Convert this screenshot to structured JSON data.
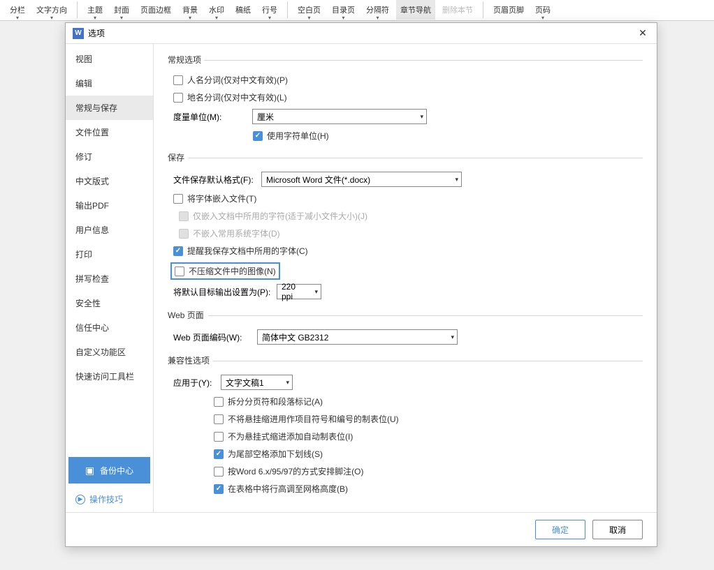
{
  "ribbon": {
    "items": [
      {
        "label": "分栏",
        "arrow": true
      },
      {
        "label": "文字方向",
        "arrow": true
      },
      {
        "label": "主题",
        "arrow": true
      },
      {
        "label": "封面",
        "arrow": true
      },
      {
        "label": "页面边框",
        "arrow": false
      },
      {
        "label": "背景",
        "arrow": true
      },
      {
        "label": "水印",
        "arrow": true
      },
      {
        "label": "稿纸",
        "arrow": false
      },
      {
        "label": "行号",
        "arrow": true
      },
      {
        "label": "空白页",
        "arrow": true
      },
      {
        "label": "目录页",
        "arrow": true
      },
      {
        "label": "分隔符",
        "arrow": true
      },
      {
        "label": "章节导航",
        "arrow": false,
        "active": true
      },
      {
        "label": "删除本节",
        "arrow": false,
        "disabled": true
      },
      {
        "label": "页眉页脚",
        "arrow": false
      },
      {
        "label": "页码",
        "arrow": true
      }
    ]
  },
  "dialog": {
    "title": "选项",
    "close": "✕"
  },
  "sidebar": {
    "items": [
      {
        "label": "视图"
      },
      {
        "label": "编辑"
      },
      {
        "label": "常规与保存",
        "active": true
      },
      {
        "label": "文件位置"
      },
      {
        "label": "修订"
      },
      {
        "label": "中文版式"
      },
      {
        "label": "输出PDF"
      },
      {
        "label": "用户信息"
      },
      {
        "label": "打印"
      },
      {
        "label": "拼写检查"
      },
      {
        "label": "安全性"
      },
      {
        "label": "信任中心"
      },
      {
        "label": "自定义功能区"
      },
      {
        "label": "快速访问工具栏"
      }
    ],
    "backup": "备份中心",
    "tips": "操作技巧"
  },
  "sections": {
    "general": {
      "title": "常规选项",
      "name_seg": "人名分词(仅对中文有效)(P)",
      "place_seg": "地名分词(仅对中文有效)(L)",
      "unit_label": "度量单位(M):",
      "unit_value": "厘米",
      "char_unit": "使用字符单位(H)"
    },
    "save": {
      "title": "保存",
      "format_label": "文件保存默认格式(F):",
      "format_value": "Microsoft Word 文件(*.docx)",
      "embed_fonts": "将字体嵌入文件(T)",
      "embed_used": "仅嵌入文档中所用的字符(适于减小文件大小)(J)",
      "no_sys_fonts": "不嵌入常用系统字体(D)",
      "remind_fonts": "提醒我保存文档中所用的字体(C)",
      "no_compress": "不压缩文件中的图像(N)",
      "output_label": "将默认目标输出设置为(P):",
      "output_value": "220 ppi"
    },
    "web": {
      "title": "Web 页面",
      "encoding_label": "Web 页面编码(W):",
      "encoding_value": "简体中文 GB2312"
    },
    "compat": {
      "title": "兼容性选项",
      "apply_label": "应用于(Y):",
      "apply_value": "文字文稿1",
      "split_break": "拆分分页符和段落标记(A)",
      "no_hang_tab": "不将悬挂缩进用作项目符号和编号的制表位(U)",
      "no_auto_tab": "不为悬挂式缩进添加自动制表位(I)",
      "underline_trail": "为尾部空格添加下划线(S)",
      "word6_footnote": "按Word 6.x/95/97的方式安排脚注(O)",
      "table_row_grid": "在表格中将行高调至网格高度(B)"
    }
  },
  "footer": {
    "ok": "确定",
    "cancel": "取消"
  }
}
